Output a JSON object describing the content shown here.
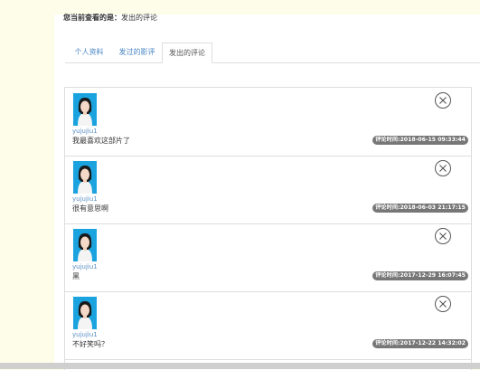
{
  "breadcrumb": {
    "label": "您当前查看的是：",
    "current": "发出的评论"
  },
  "tabs": [
    {
      "label": "个人资料"
    },
    {
      "label": "发过的影评"
    },
    {
      "label": "发出的评论"
    }
  ],
  "comments": [
    {
      "username": "yujujiu1",
      "text": "我最喜欢这部片了",
      "time": "评论时间:2018-06-15 09:33:44"
    },
    {
      "username": "yujujiu1",
      "text": "很有意思啊",
      "time": "评论时间:2018-06-03 21:17:15"
    },
    {
      "username": "yujujiu1",
      "text": "黑",
      "time": "评论时间:2017-12-29 16:07:45"
    },
    {
      "username": "yujujiu1",
      "text": "不好笑吗？",
      "time": "评论时间:2017-12-22 14:32:02"
    }
  ],
  "colors": {
    "accent": "#4a86c5",
    "avatar_bg": "#1aa3df",
    "time_badge": "#777777",
    "page_bg": "#fefde9"
  },
  "icons": {
    "delete": "close-circle-icon"
  }
}
